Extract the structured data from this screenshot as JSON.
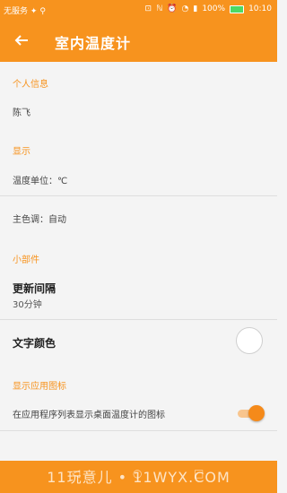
{
  "status_bar": {
    "carrier": "无服务",
    "battery": "100%",
    "time": "10:10"
  },
  "toolbar": {
    "title": "室内温度计"
  },
  "sections": {
    "personal": {
      "header": "个人信息",
      "name": "陈飞"
    },
    "display": {
      "header": "显示",
      "unit": "温度单位：℃",
      "theme": "主色调：自动"
    },
    "widget": {
      "header": "小部件",
      "interval_title": "更新间隔",
      "interval_value": "30分钟",
      "text_color_title": "文字颜色"
    },
    "app_icon": {
      "header": "显示应用图标",
      "toggle_label": "在应用程序列表显示桌面温度计的图标",
      "toggle_on": true
    }
  },
  "watermark": "11玩意儿 • 11WYX.COM",
  "colors": {
    "accent": "#f7931e",
    "toggle_thumb": "#f58a1a",
    "toggle_track": "#f8c58e"
  }
}
